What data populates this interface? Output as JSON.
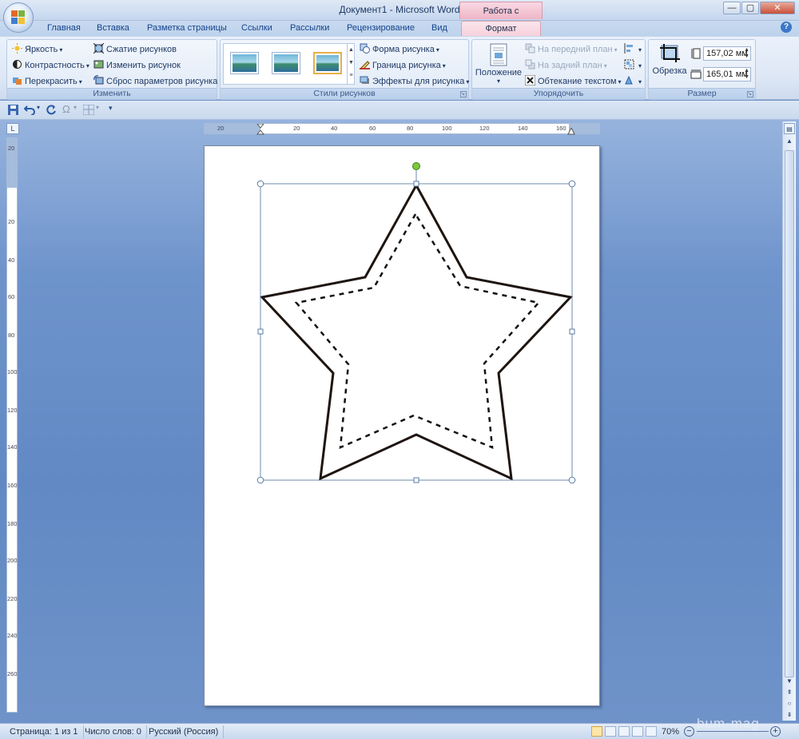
{
  "window": {
    "title": "Документ1 - Microsoft Word",
    "context_banner": "Работа с рисунками",
    "buttons": [
      "—",
      "▢",
      "✕"
    ]
  },
  "tabs": [
    "Главная",
    "Вставка",
    "Разметка страницы",
    "Ссылки",
    "Рассылки",
    "Рецензирование",
    "Вид",
    "Формат"
  ],
  "ribbon": {
    "izmenit": {
      "label": "Изменить",
      "brightness": "Яркость",
      "contrast": "Контрастность",
      "recolor": "Перекрасить",
      "compress": "Сжатие рисунков",
      "change": "Изменить рисунок",
      "reset": "Сброс параметров рисунка"
    },
    "styles": {
      "label": "Стили рисунков",
      "shape": "Форма рисунка",
      "border": "Граница рисунка",
      "effects": "Эффекты для рисунка"
    },
    "arrange": {
      "label": "Упорядочить",
      "position": "Положение",
      "front": "На передний план",
      "back": "На задний план",
      "wrap": "Обтекание текстом"
    },
    "size": {
      "label": "Размер",
      "crop": "Обрезка",
      "height": "157,02 мм",
      "width": "165,01 мм"
    }
  },
  "ruler": {
    "h_ticks": [
      "20",
      "20",
      "40",
      "60",
      "80",
      "100",
      "120",
      "140",
      "160"
    ],
    "v_ticks": [
      "20",
      "20",
      "40",
      "60",
      "80",
      "100",
      "120",
      "140",
      "160",
      "180",
      "200",
      "220",
      "240",
      "260"
    ]
  },
  "status": {
    "page": "Страница: 1 из 1",
    "words": "Число слов: 0",
    "lang": "Русский (Россия)",
    "zoom": "70%"
  },
  "watermark": "bum-mag",
  "colors": {
    "accent": "#15428b",
    "context_tab": "#f7cfdb",
    "selection_handle": "#7cc83c"
  }
}
